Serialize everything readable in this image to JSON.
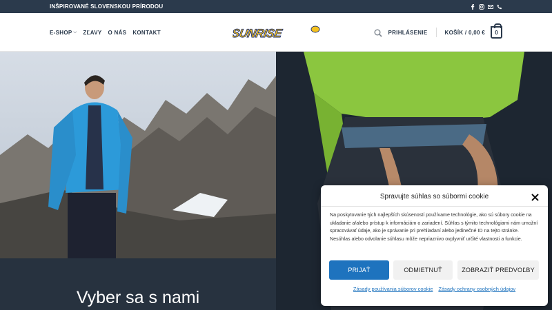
{
  "topbar": {
    "tagline": "INŠPIROVANÉ SLOVENSKOU PRÍRODOU",
    "icons": [
      "facebook-icon",
      "instagram-icon",
      "mail-icon",
      "phone-icon"
    ]
  },
  "nav": {
    "eshop": "E-SHOP",
    "sale": "ZĽAVY",
    "about": "O NÁS",
    "contact": "KONTAKT",
    "login": "PRIHLÁSENIE",
    "cart": "KOŠÍK / 0,00 €",
    "cart_count": "0"
  },
  "logo": {
    "text": "SUNRISE",
    "colors": {
      "text": "#f4c11f",
      "outline": "#1c2f6e"
    }
  },
  "hero": {
    "headline": "Vyber sa s nami"
  },
  "cookie": {
    "title": "Spravujte súhlas so súbormi cookie",
    "body": "Na poskytovanie tých najlepších skúseností používame technológie, ako sú súbory cookie na ukladanie a/alebo prístup k informáciám o zariadení. Súhlas s týmito technológiami nám umožní spracovávať údaje, ako je správanie pri prehliadaní alebo jedinečné ID na tejto stránke. Nesúhlas alebo odvolanie súhlasu môže nepriaznivo ovplyvniť určité vlastnosti a funkcie.",
    "accept": "PRIJAŤ",
    "deny": "ODMIETNUŤ",
    "prefs": "ZOBRAZIŤ PREDVOĽBY",
    "link_cookies": "Zásady používania súborov cookie",
    "link_privacy": "Zásady ochrany osobných údajov"
  },
  "colors": {
    "topbar": "#2b3a4c",
    "accent": "#1e73be",
    "band": "#27323f"
  }
}
